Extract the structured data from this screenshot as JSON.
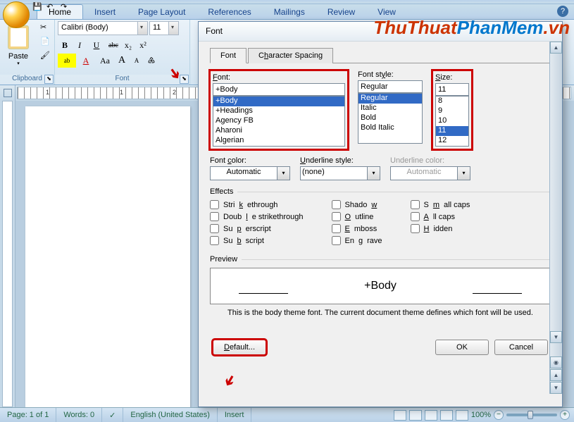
{
  "app": {
    "help": "?"
  },
  "watermark": {
    "t1": "ThuThuat",
    "t2": "PhanMem",
    "t3": ".vn"
  },
  "ribbon": {
    "tabs": [
      "Home",
      "Insert",
      "Page Layout",
      "References",
      "Mailings",
      "Review",
      "View"
    ],
    "active": 0,
    "clipboard": {
      "paste": "Paste",
      "label": "Clipboard"
    },
    "font": {
      "label": "Font",
      "name": "Calibri (Body)",
      "size": "11",
      "bold": "B",
      "italic": "I",
      "underline": "U",
      "strike": "abc",
      "sub": "x₂",
      "sup": "x²",
      "highlight": "ab",
      "color": "A",
      "case": "Aa",
      "grow": "A",
      "shrink": "A",
      "clear": "♶"
    }
  },
  "ruler": {
    "nums": [
      "1",
      "",
      "1",
      "2"
    ]
  },
  "dialog": {
    "title": "Font",
    "tabs": [
      "Font",
      "Character Spacing"
    ],
    "activeTab": 0,
    "font_label": "Font:",
    "font_value": "+Body",
    "font_items": [
      "+Body",
      "+Headings",
      "Agency FB",
      "Aharoni",
      "Algerian"
    ],
    "font_sel": 0,
    "style_label": "Font style:",
    "style_value": "Regular",
    "style_items": [
      "Regular",
      "Italic",
      "Bold",
      "Bold Italic"
    ],
    "style_sel": 0,
    "size_label": "Size:",
    "size_value": "11",
    "size_items": [
      "8",
      "9",
      "10",
      "11",
      "12"
    ],
    "size_sel": 3,
    "fontcolor_label": "Font color:",
    "fontcolor_value": "Automatic",
    "ustyle_label": "Underline style:",
    "ustyle_value": "(none)",
    "ucolor_label": "Underline color:",
    "ucolor_value": "Automatic",
    "effects_label": "Effects",
    "effects": {
      "c1": [
        "Strikethrough",
        "Double strikethrough",
        "Superscript",
        "Subscript"
      ],
      "c2": [
        "Shadow",
        "Outline",
        "Emboss",
        "Engrave"
      ],
      "c3": [
        "Small caps",
        "All caps",
        "Hidden"
      ]
    },
    "preview_label": "Preview",
    "preview_text": "+Body",
    "preview_desc": "This is the body theme font. The current document theme defines which font will be used.",
    "default": "Default...",
    "ok": "OK",
    "cancel": "Cancel"
  },
  "status": {
    "page": "Page: 1 of 1",
    "words": "Words: 0",
    "lang": "English (United States)",
    "mode": "Insert",
    "zoom": "100%",
    "minus": "−",
    "plus": "+"
  }
}
